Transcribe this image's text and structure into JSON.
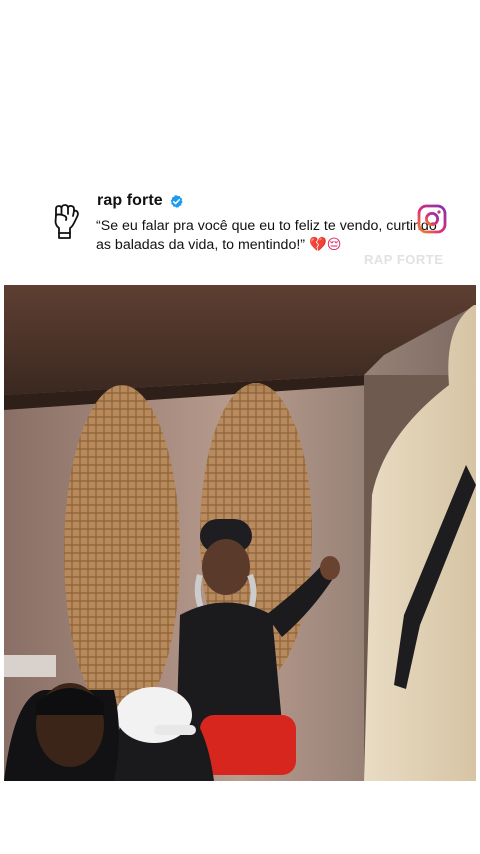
{
  "post": {
    "account_name": "rap forte",
    "caption_line1": "“Se eu falar pra você que eu to feliz te vendo, curtindo",
    "caption_line2": "as baladas da vida, to mentindo!”",
    "caption_emojis": "💔😔",
    "watermark": "RAP FORTE"
  },
  "icons": {
    "avatar": "raised-fist-icon",
    "verified": "verified-badge-icon",
    "app": "instagram-icon"
  },
  "colors": {
    "verified_blue": "#1d9bf0",
    "heart": "#e0245e",
    "instagram_gradient_start": "#f58529",
    "instagram_gradient_end": "#8134af"
  }
}
